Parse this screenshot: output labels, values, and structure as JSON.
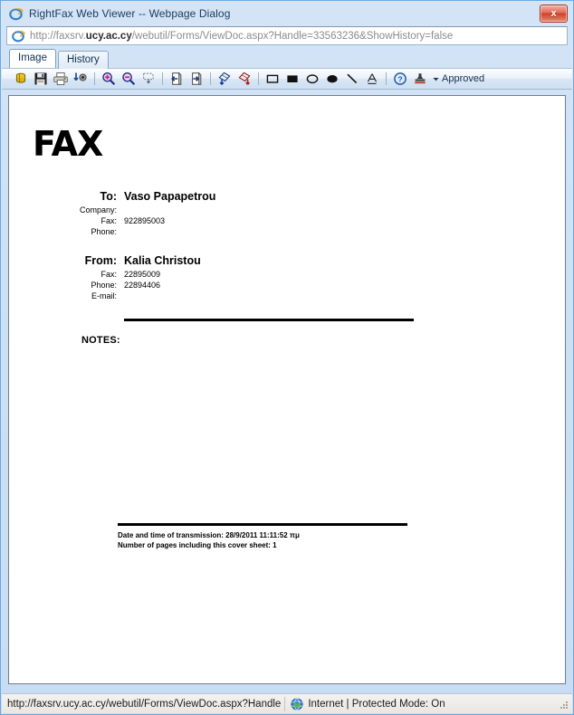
{
  "window": {
    "title": "RightFax Web Viewer -- Webpage Dialog",
    "close_label": "x",
    "app_icon": "internet-explorer-icon"
  },
  "address_bar": {
    "url_prefix": "http://faxsrv.",
    "url_domain": "ucy.ac.cy",
    "url_suffix": "/webutil/Forms/ViewDoc.aspx?Handle=33563236&ShowHistory=false",
    "icon": "internet-explorer-icon"
  },
  "tabs": [
    {
      "label": "Image",
      "active": true
    },
    {
      "label": "History",
      "active": false
    }
  ],
  "toolbar": {
    "buttons": [
      {
        "name": "stack-icon",
        "title": "Document Stack"
      },
      {
        "name": "save-icon",
        "title": "Save"
      },
      {
        "name": "print-icon",
        "title": "Print"
      },
      {
        "name": "send-icon",
        "title": "Send"
      },
      {
        "name": "zoom-in-icon",
        "title": "Zoom In"
      },
      {
        "name": "zoom-out-icon",
        "title": "Zoom Out"
      },
      {
        "name": "fit-page-icon",
        "title": "Fit Page"
      },
      {
        "name": "previous-page-icon",
        "title": "Previous Page"
      },
      {
        "name": "next-page-icon",
        "title": "Next Page"
      },
      {
        "name": "rotate-left-icon",
        "title": "Rotate Left"
      },
      {
        "name": "rotate-right-icon",
        "title": "Rotate Right"
      },
      {
        "name": "rectangle-outline-icon",
        "title": "Rectangle"
      },
      {
        "name": "rectangle-filled-icon",
        "title": "Filled Rectangle"
      },
      {
        "name": "ellipse-outline-icon",
        "title": "Ellipse"
      },
      {
        "name": "ellipse-filled-icon",
        "title": "Filled Ellipse"
      },
      {
        "name": "line-icon",
        "title": "Line"
      },
      {
        "name": "text-annotation-icon",
        "title": "Text"
      },
      {
        "name": "help-icon",
        "title": "Help"
      },
      {
        "name": "stamp-icon",
        "title": "Stamp"
      }
    ],
    "stamp_dropdown_label": "Approved"
  },
  "document": {
    "heading": "FAX",
    "to": {
      "name_label": "To:",
      "name_value": "Vaso Papapetrou",
      "company_label": "Company:",
      "company_value": "",
      "fax_label": "Fax:",
      "fax_value": "922895003",
      "phone_label": "Phone:",
      "phone_value": ""
    },
    "from": {
      "name_label": "From:",
      "name_value": "Kalia Christou",
      "fax_label": "Fax:",
      "fax_value": "22895009",
      "phone_label": "Phone:",
      "phone_value": "22894406",
      "email_label": "E-mail:",
      "email_value": ""
    },
    "notes_label": "NOTES:",
    "footer": {
      "transmission": "Date and time of transmission: 28/9/2011 11:11:52 πμ",
      "pages": "Number of pages including this cover sheet: 1"
    }
  },
  "status_bar": {
    "url": "http://faxsrv.ucy.ac.cy/webutil/Forms/ViewDoc.aspx?Handle",
    "zone": "Internet | Protected Mode: On",
    "zone_icon": "globe-icon"
  }
}
